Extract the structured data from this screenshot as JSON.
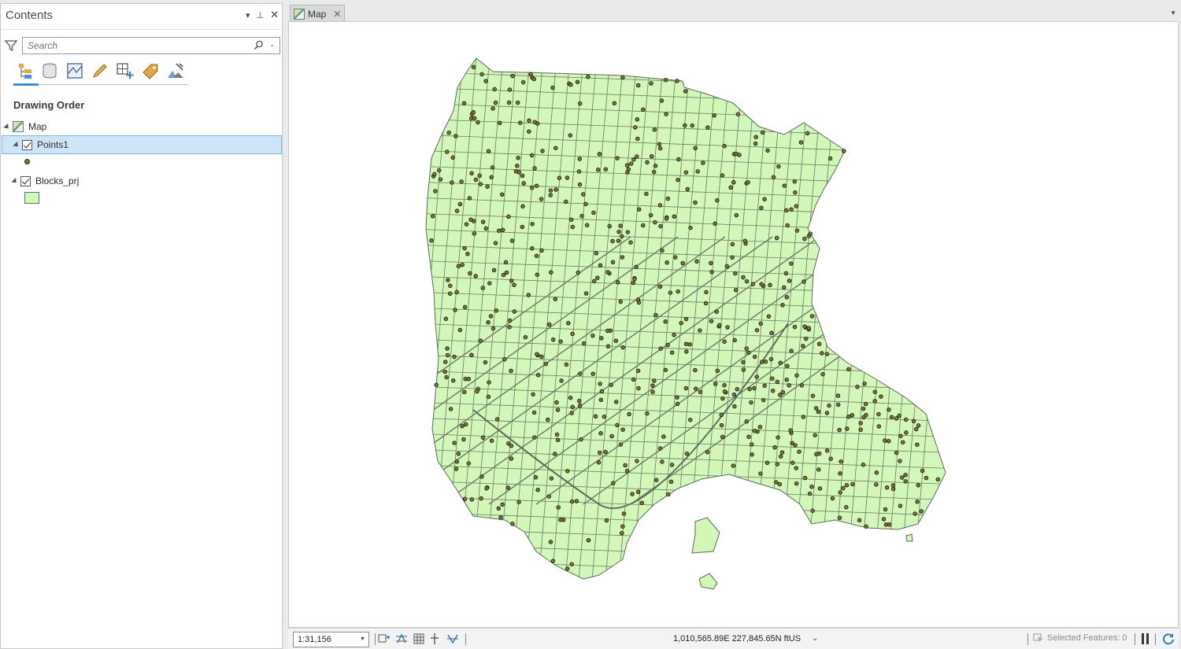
{
  "contents": {
    "title": "Contents",
    "controls": {
      "menu": "▾",
      "pin": "⊥",
      "close": "✕"
    },
    "search": {
      "placeholder": "Search",
      "value": ""
    },
    "tools": [
      "list-by-drawing-order",
      "list-by-source",
      "list-by-selection",
      "list-by-editing",
      "list-by-snapping",
      "list-by-labeling",
      "list-by-perspective-imagery"
    ],
    "section_heading": "Drawing Order",
    "tree": {
      "map_label": "Map",
      "layers": [
        {
          "name": "Points1",
          "checked": true,
          "selected": true,
          "symbol": "point",
          "color": "#7d7a2a"
        },
        {
          "name": "Blocks_prj",
          "checked": true,
          "selected": false,
          "symbol": "polygon",
          "color": "#d3f7b8"
        }
      ]
    }
  },
  "map_view": {
    "tab_label": "Map",
    "tab_close": "✕",
    "polygon_fill": "#d3f7b8",
    "outline_color": "#5a6a5a",
    "point_fill": "#7d7a2a"
  },
  "status_bar": {
    "scale": "1:31,156",
    "coordinates": "1,010,565.89E 227,845.65N ftUS",
    "selected_features": "Selected Features: 0"
  }
}
